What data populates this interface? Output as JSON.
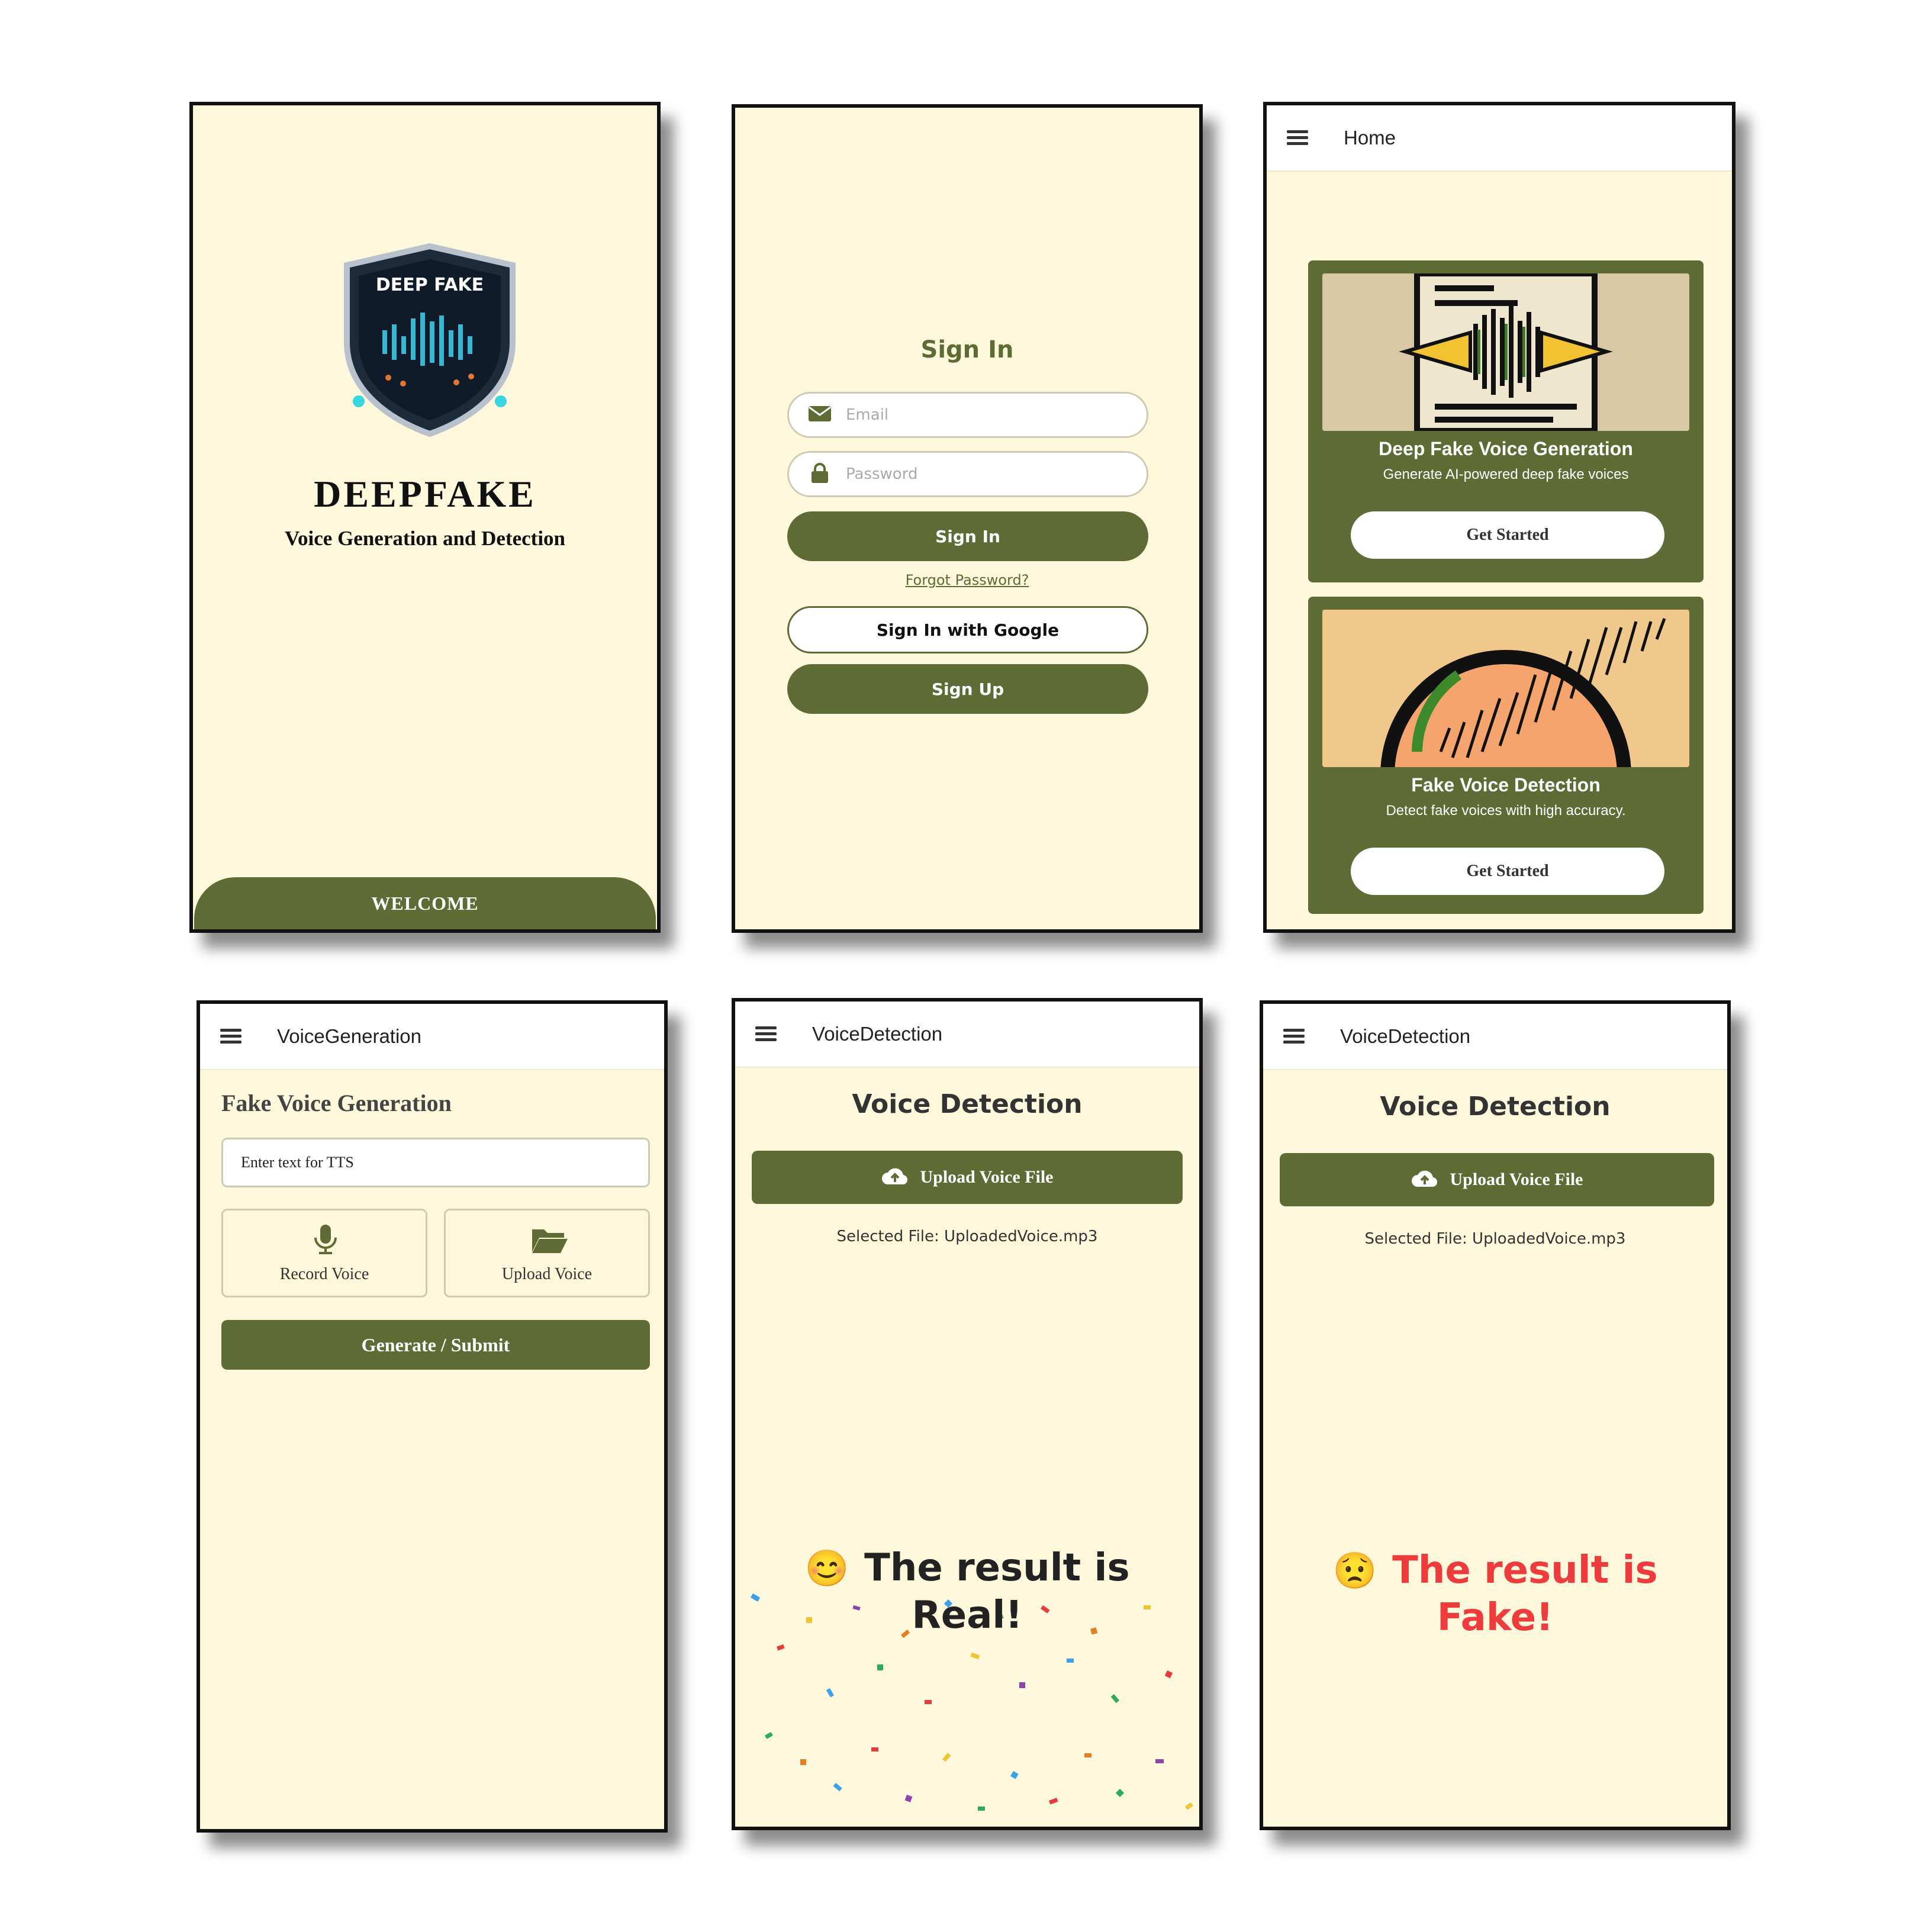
{
  "splash": {
    "shield_text": "DEEP FAKE",
    "title": "DEEPFAKE",
    "subtitle": "Voice Generation and Detection",
    "welcome_label": "WELCOME"
  },
  "signin": {
    "heading": "Sign In",
    "email_placeholder": "Email",
    "password_placeholder": "Password",
    "signin_label": "Sign In",
    "forgot_label": "Forgot Password?",
    "google_label": "Sign In with Google",
    "signup_label": "Sign Up"
  },
  "home": {
    "appbar_title": "Home",
    "cards": [
      {
        "title": "Deep Fake Voice Generation",
        "description": "Generate AI-powered deep fake voices",
        "button": "Get Started"
      },
      {
        "title": "Fake Voice Detection",
        "description": "Detect fake voices with high accuracy.",
        "button": "Get Started"
      }
    ]
  },
  "generation": {
    "appbar_title": "VoiceGeneration",
    "heading": "Fake Voice Generation",
    "input_placeholder": "Enter text for TTS",
    "record_label": "Record Voice",
    "upload_label": "Upload Voice",
    "submit_label": "Generate / Submit"
  },
  "detection_real": {
    "appbar_title": "VoiceDetection",
    "heading": "Voice Detection",
    "upload_label": "Upload Voice File",
    "selected_file": "Selected File: UploadedVoice.mp3",
    "result_line1": "The result is",
    "result_line2": "Real!",
    "emoji": "😊",
    "result_color": "#222222"
  },
  "detection_fake": {
    "appbar_title": "VoiceDetection",
    "heading": "Voice Detection",
    "upload_label": "Upload Voice File",
    "selected_file": "Selected File: UploadedVoice.mp3",
    "result_line1": "The result is",
    "result_line2": "Fake!",
    "emoji": "😟",
    "result_color": "#ee3b3b"
  },
  "colors": {
    "accent": "#5e6b35",
    "background": "#fdf8dc",
    "fake": "#ee3b3b"
  }
}
